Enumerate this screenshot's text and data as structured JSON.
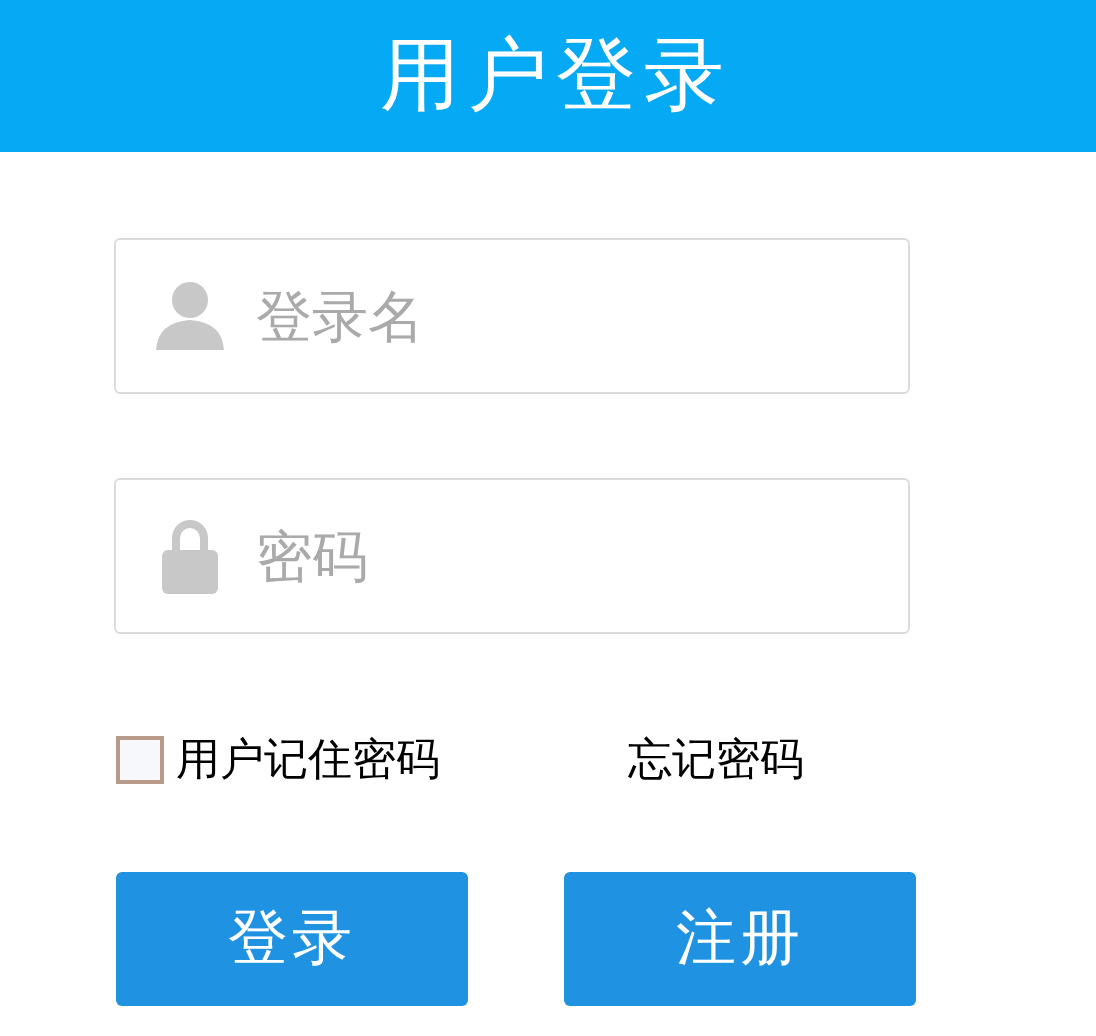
{
  "title": "用户登录",
  "fields": [
    {
      "kind": "user",
      "placeholder": "登录名"
    },
    {
      "kind": "password",
      "placeholder": "密码"
    }
  ],
  "remember": {
    "label": "用户记住密码",
    "checked": false
  },
  "forgot_link": "忘记密码",
  "buttons": [
    "登录",
    "注册"
  ]
}
